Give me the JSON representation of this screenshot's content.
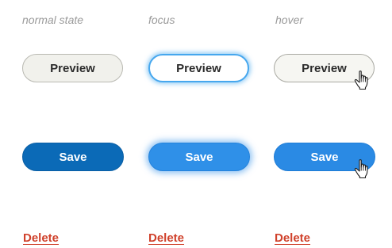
{
  "states": {
    "normal": "normal state",
    "focus": "focus",
    "hover": "hover"
  },
  "buttons": {
    "preview_label": "Preview",
    "save_label": "Save",
    "delete_label": "Delete"
  },
  "icons": {
    "cursor": "hand-pointer-icon"
  },
  "colors": {
    "primary": "#0b6ab7",
    "primary_focus": "#2f90e8",
    "focus_ring": "#46a7ee",
    "danger": "#d0412b",
    "secondary_bg": "#f1f1ec"
  }
}
